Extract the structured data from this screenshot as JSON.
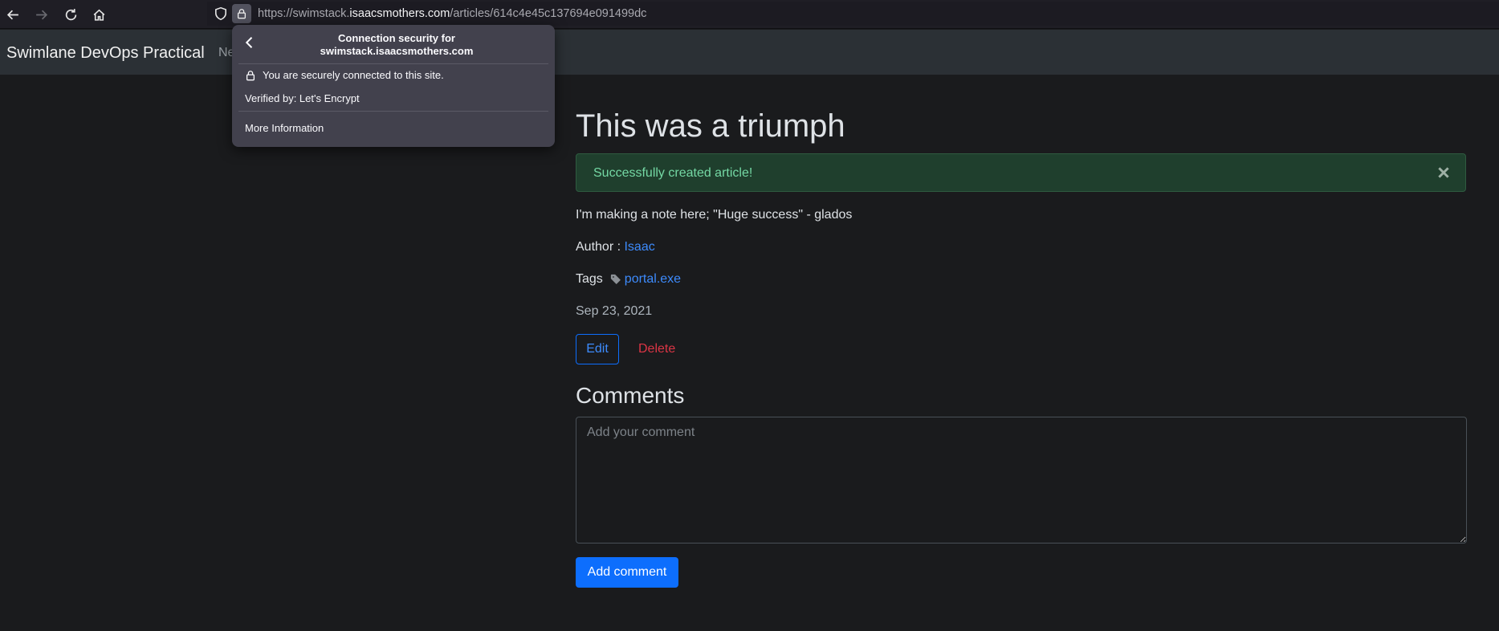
{
  "browser": {
    "url_prefix": "https://swimstack.",
    "url_host": "isaacsmothers.com",
    "url_path": "/articles/614c4e45c137694e091499dc",
    "icons": [
      "back-icon",
      "forward-icon",
      "reload-icon",
      "home-icon",
      "shield-icon",
      "lock-icon"
    ]
  },
  "popup": {
    "title_line1": "Connection security for",
    "title_line2": "swimstack.isaacsmothers.com",
    "secure_text": "You are securely connected to this site.",
    "verified_text": "Verified by: Let's Encrypt",
    "more_info": "More Information"
  },
  "site": {
    "brand": "Swimlane DevOps Practical",
    "nav_link_partial": "Ne"
  },
  "article": {
    "title": "This was a triumph",
    "alert": "Successfully created article!",
    "body": "I'm making a note here; \"Huge success\" - glados",
    "author_label": "Author : ",
    "author_name": "Isaac",
    "tags_label": "Tags",
    "tag": "portal.exe",
    "date": "Sep 23, 2021",
    "edit_label": "Edit",
    "delete_label": "Delete"
  },
  "comments": {
    "heading": "Comments",
    "placeholder": "Add your comment",
    "submit_label": "Add comment"
  },
  "colors": {
    "background": "#1a1b1d",
    "navbar": "#2b3035",
    "primary": "#0d6efd",
    "link": "#3d8bfd",
    "danger": "#dc3545",
    "success_bg": "#1f3f2d",
    "success_text": "#74d8a4"
  }
}
